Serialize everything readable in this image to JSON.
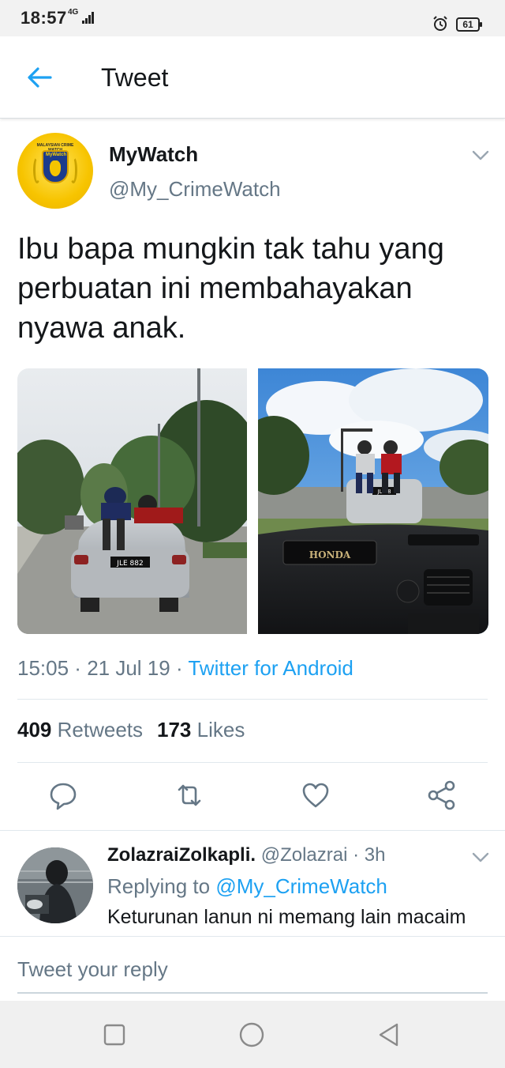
{
  "status_bar": {
    "time": "18:57",
    "network": "4G",
    "battery": "61"
  },
  "header": {
    "title": "Tweet",
    "accent": "#1da1f2"
  },
  "tweet": {
    "author_name": "MyWatch",
    "author_handle": "@My_CrimeWatch",
    "avatar_banner": "MALAYSIAN CRIME WATCH",
    "avatar_crest": "MyWatch",
    "text": "Ibu bapa mungkin tak tahu yang perbuatan ini membahayakan nyawa anak.",
    "photos": [
      {
        "plate": "JLE 882"
      },
      {
        "plate": "JLE 8",
        "dash_badge": "HONDA"
      }
    ],
    "time": "15:05",
    "date": "21 Jul 19",
    "source": "Twitter for Android",
    "retweets_count": "409",
    "retweets_label": "Retweets",
    "likes_count": "173",
    "likes_label": "Likes",
    "actions": [
      "reply-icon",
      "retweet-icon",
      "like-icon",
      "share-icon"
    ]
  },
  "reply": {
    "author_name": "ZolazraiZolkapli.",
    "author_handle": "@Zolazrai",
    "time": "3h",
    "replying_to_label": "Replying to",
    "replying_to_handle": "@My_CrimeWatch",
    "text": "Keturunan lanun ni memang lain macaim"
  },
  "composer": {
    "placeholder": "Tweet your reply"
  },
  "nav": {
    "buttons": [
      "recent-apps",
      "home",
      "back"
    ]
  },
  "colors": {
    "primary_text": "#14171a",
    "secondary_text": "#657786",
    "link": "#1da1f2"
  }
}
